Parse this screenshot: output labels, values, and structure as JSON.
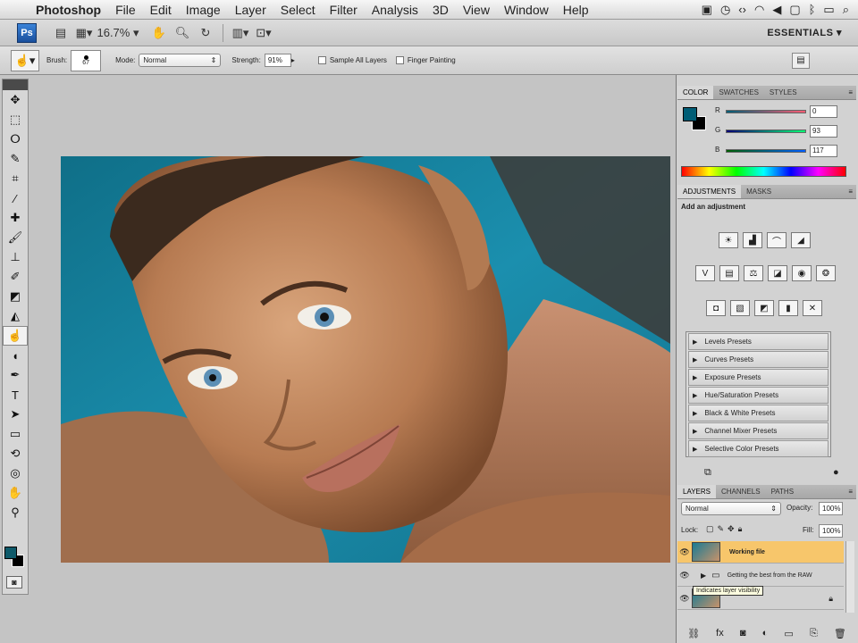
{
  "menubar": {
    "apple": "",
    "app_name": "Photoshop",
    "items": [
      "File",
      "Edit",
      "Image",
      "Layer",
      "Select",
      "Filter",
      "Analysis",
      "3D",
      "View",
      "Window",
      "Help"
    ]
  },
  "appbar": {
    "ps_logo": "Ps",
    "zoom": "16.7%",
    "workspace": "ESSENTIALS"
  },
  "options": {
    "brush_label": "Brush:",
    "brush_size": "67",
    "mode_label": "Mode:",
    "mode_value": "Normal",
    "strength_label": "Strength:",
    "strength_value": "91%",
    "sample_all_layers": "Sample All Layers",
    "finger_painting": "Finger Painting"
  },
  "color_panel": {
    "tabs": [
      "COLOR",
      "SWATCHES",
      "STYLES"
    ],
    "r_label": "R",
    "g_label": "G",
    "b_label": "B",
    "r_value": "0",
    "g_value": "93",
    "b_value": "117",
    "fg_color": "#005d75"
  },
  "adjustments_panel": {
    "tabs": [
      "ADJUSTMENTS",
      "MASKS"
    ],
    "heading": "Add an adjustment",
    "presets": [
      "Levels Presets",
      "Curves Presets",
      "Exposure Presets",
      "Hue/Saturation Presets",
      "Black & White Presets",
      "Channel Mixer Presets",
      "Selective Color Presets"
    ]
  },
  "layers_panel": {
    "tabs": [
      "LAYERS",
      "CHANNELS",
      "PATHS"
    ],
    "blend_mode": "Normal",
    "opacity_label": "Opacity:",
    "opacity_value": "100%",
    "lock_label": "Lock:",
    "fill_label": "Fill:",
    "fill_value": "100%",
    "layers": [
      {
        "name": "Working file",
        "selected": true
      },
      {
        "name": "Getting the best from the RAW",
        "selected": false
      }
    ],
    "tooltip": "Indicates layer visibility"
  }
}
